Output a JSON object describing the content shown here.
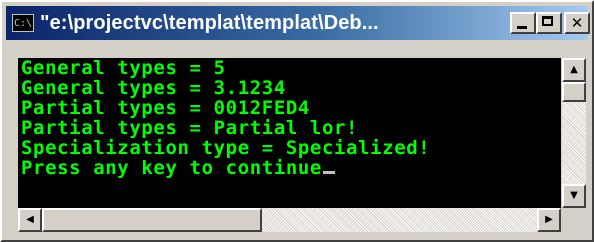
{
  "window": {
    "title": "\"e:\\projectvc\\templat\\templat\\Deb...",
    "system_icon_text": "C:\\",
    "controls": {
      "minimize_icon": "minimize-icon",
      "maximize_icon": "maximize-icon",
      "close_glyph": "✕"
    }
  },
  "console": {
    "lines": [
      "General types = 5",
      "General types = 3.1234",
      "Partial types = 0012FED4",
      "Partial types = Partial lor!",
      "Specialization type = Specialized!",
      "Press any key to continue"
    ],
    "text_color": "#00ff00",
    "background_color": "#000000"
  },
  "scrollbars": {
    "up_arrow": "▲",
    "down_arrow": "▼",
    "left_arrow": "◀",
    "right_arrow": "▶"
  }
}
